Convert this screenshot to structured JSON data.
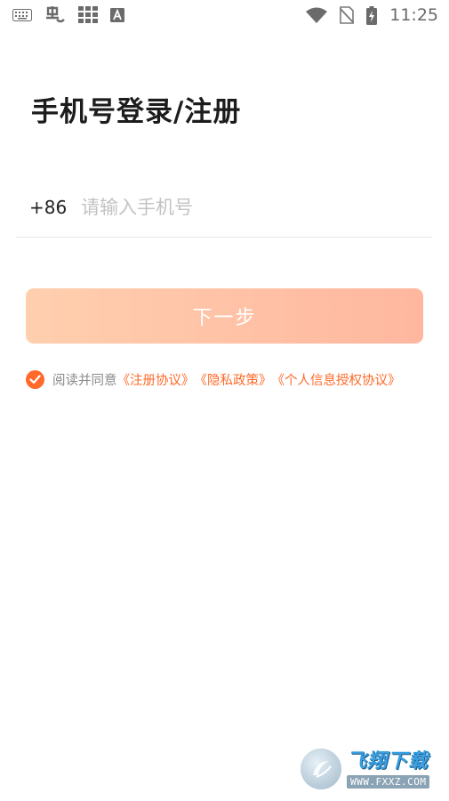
{
  "status_bar": {
    "time": "11:25",
    "left_icons": [
      "keyboard-icon",
      "app-notification-icon",
      "grid-app-icon",
      "a-badge-icon"
    ],
    "right_icons": [
      "wifi-icon",
      "no-sim-icon",
      "battery-charging-icon"
    ]
  },
  "login": {
    "title": "手机号登录/注册",
    "country_code": "+86",
    "phone_placeholder": "请输入手机号",
    "phone_value": "",
    "next_button": "下一步"
  },
  "agreement": {
    "checked": true,
    "prefix": "阅读并同意",
    "links": [
      "《注册协议》",
      "《隐私政策》",
      "《个人信息授权协议》"
    ]
  },
  "watermark": {
    "brand": "飞翔下载",
    "url": "WWW.FXXZ.COM"
  },
  "colors": {
    "accent": "#ff6a2b",
    "button_gradient_start": "#ffcfae",
    "button_gradient_end": "#ffb7a0",
    "placeholder": "#c3c3c3"
  }
}
